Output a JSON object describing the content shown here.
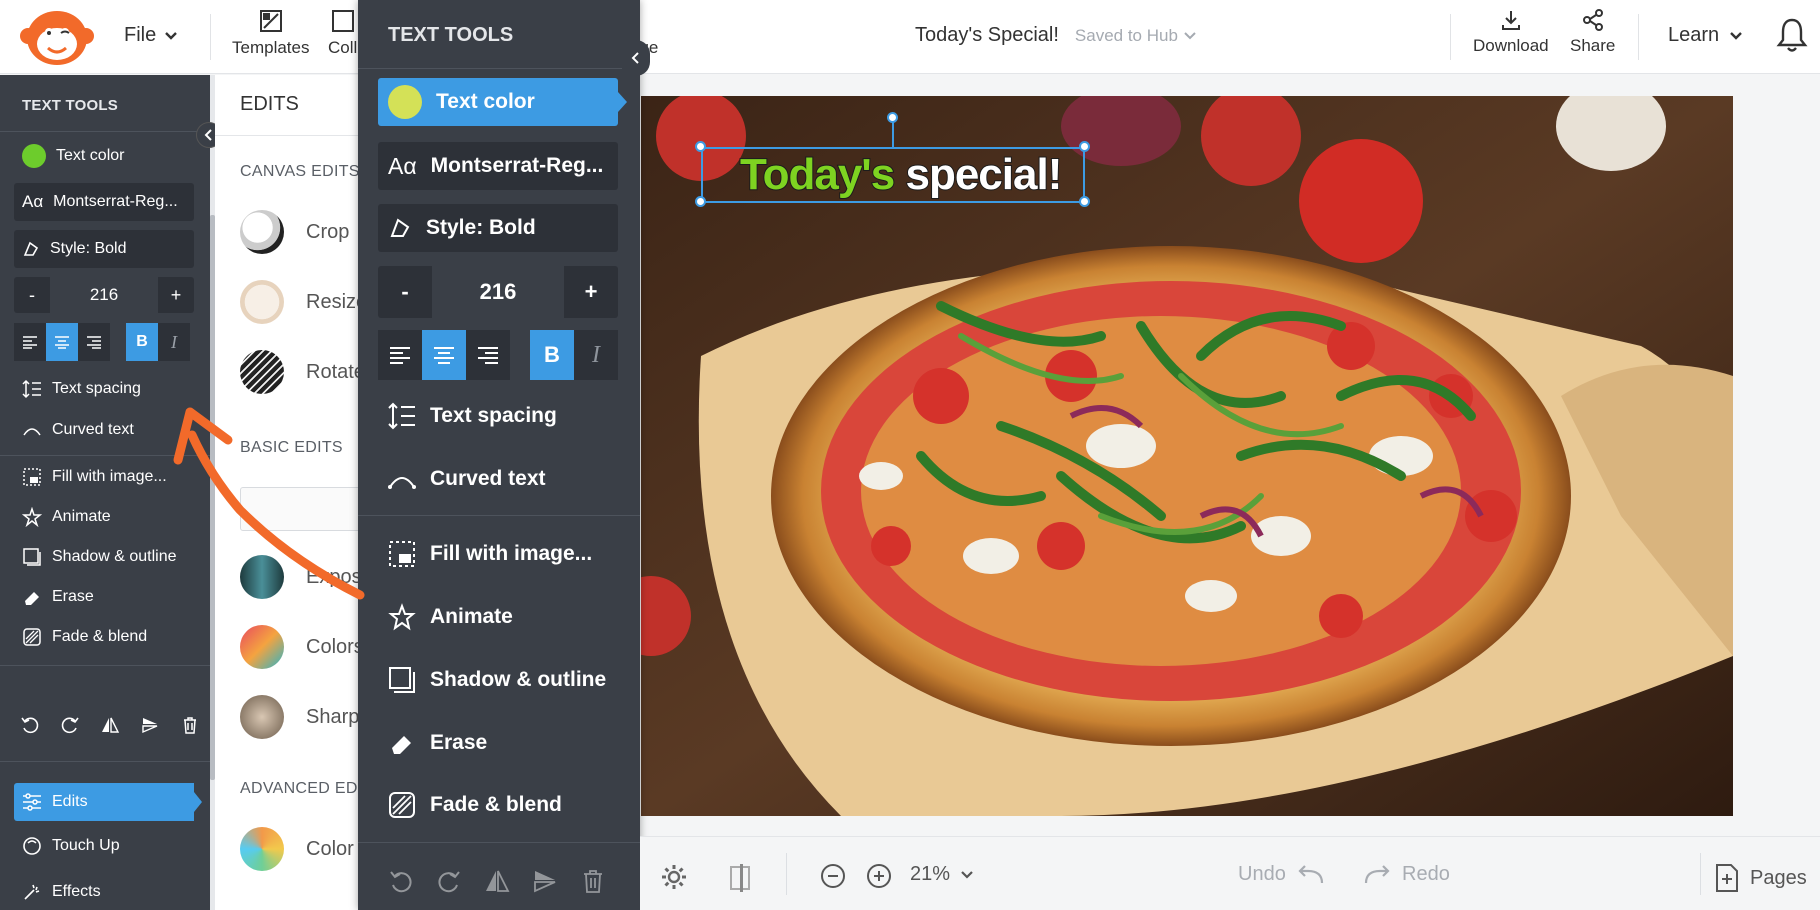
{
  "topbar": {
    "file_label": "File",
    "templates_label": "Templates",
    "collage_label": "Coll",
    "image_label": "age",
    "doc_title": "Today's Special!",
    "saved_status": "Saved to Hub",
    "download_label": "Download",
    "share_label": "Share",
    "learn_label": "Learn"
  },
  "left_panel": {
    "header": "TEXT TOOLS",
    "text_color_label": "Text color",
    "text_color": "#6dcc2c",
    "font_label": "Montserrat-Reg...",
    "style_label": "Style: Bold",
    "minus": "-",
    "size_value": "216",
    "plus": "+",
    "bold_label": "B",
    "italic_label": "I",
    "text_spacing_label": "Text spacing",
    "curved_text_label": "Curved text",
    "fill_label": "Fill with image...",
    "animate_label": "Animate",
    "shadow_label": "Shadow & outline",
    "erase_label": "Erase",
    "fade_label": "Fade & blend",
    "nav": {
      "edits_label": "Edits",
      "touchup_label": "Touch Up",
      "effects_label": "Effects"
    }
  },
  "edits_panel": {
    "title": "EDITS",
    "canvas_edits": "CANVAS EDITS",
    "crop": "Crop",
    "resize": "Resize",
    "rotate": "Rotate",
    "basic_edits": "BASIC EDITS",
    "exposure": "Exposure",
    "colors": "Colors",
    "sharpen": "Sharpen",
    "advanced_edits": "ADVANCED EDITS",
    "color_changer": "Color"
  },
  "big_panel": {
    "header": "TEXT TOOLS",
    "text_color_label": "Text color",
    "text_color": "#d4e157",
    "font_label": "Montserrat-Reg...",
    "style_label": "Style: Bold",
    "minus": "-",
    "size_value": "216",
    "plus": "+",
    "bold_label": "B",
    "italic_label": "I",
    "text_spacing_label": "Text spacing",
    "curved_text_label": "Curved text",
    "fill_label": "Fill with image...",
    "animate_label": "Animate",
    "shadow_label": "Shadow & outline",
    "erase_label": "Erase",
    "fade_label": "Fade & blend"
  },
  "canvas": {
    "overlay_word1": "Today's",
    "overlay_word2": "special!"
  },
  "bottombar": {
    "zoom": "21%",
    "undo": "Undo",
    "redo": "Redo",
    "pages": "Pages"
  },
  "colors": {
    "accent": "#3d9be3",
    "panel_dark": "#3a3f47",
    "annotation_arrow": "#f26a2a"
  }
}
